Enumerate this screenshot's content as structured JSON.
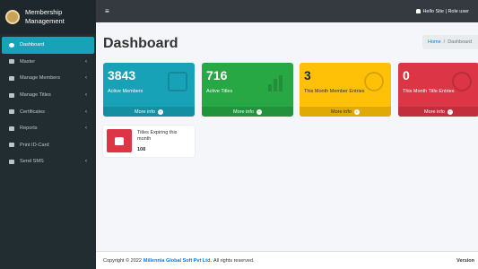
{
  "app": {
    "title": "Membership Management"
  },
  "sidebar": {
    "items": [
      {
        "label": "Dashboard",
        "active": true,
        "has_children": false
      },
      {
        "label": "Master",
        "active": false,
        "has_children": true
      },
      {
        "label": "Manage Members",
        "active": false,
        "has_children": true
      },
      {
        "label": "Manage Titles",
        "active": false,
        "has_children": true
      },
      {
        "label": "Certificates",
        "active": false,
        "has_children": true
      },
      {
        "label": "Reports",
        "active": false,
        "has_children": true
      },
      {
        "label": "Print ID-Card",
        "active": false,
        "has_children": false
      },
      {
        "label": "Send SMS",
        "active": false,
        "has_children": true
      }
    ]
  },
  "topbar": {
    "menu_icon": "hamburger-icon",
    "user_text": "Hello Site | Role user"
  },
  "page": {
    "title": "Dashboard",
    "breadcrumb": {
      "home": "Home",
      "separator": "/",
      "current": "Dashboard"
    }
  },
  "stats": [
    {
      "value": "3843",
      "label": "Active Members",
      "footer": "More info",
      "color": "#17a2b8",
      "icon": "bag-icon"
    },
    {
      "value": "716",
      "label": "Active Titles",
      "footer": "More info",
      "color": "#28a745",
      "icon": "bar-chart-icon"
    },
    {
      "value": "3",
      "label": "This Month Member Entries",
      "footer": "More info",
      "color": "#ffc107",
      "icon": "user-plus-icon"
    },
    {
      "value": "0",
      "label": "This Month Title Entries",
      "footer": "More info",
      "color": "#dc3545",
      "icon": "pie-chart-icon"
    }
  ],
  "expiring": {
    "label": "Titles Expiring this month",
    "value": "108",
    "color": "#dc3545",
    "icon": "thumbs-up-icon"
  },
  "footer": {
    "prefix": "Copyright © 2022",
    "company": "Millennia Global Soft Pvt Ltd.",
    "suffix": "All rights reserved.",
    "version": "Version"
  }
}
